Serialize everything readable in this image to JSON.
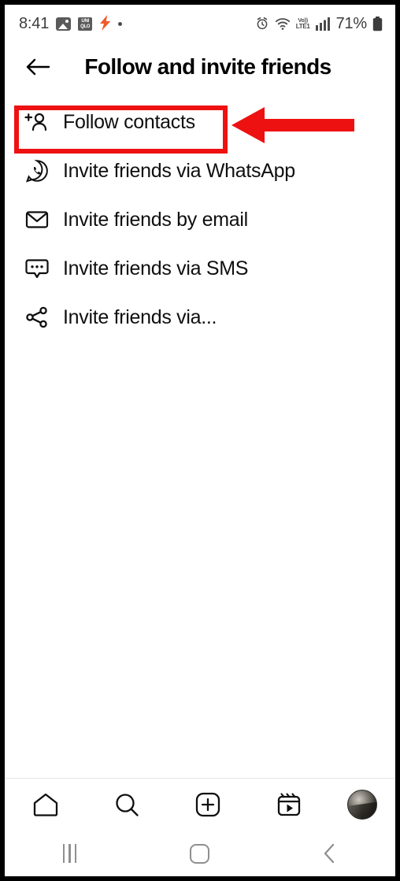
{
  "status_bar": {
    "time": "8:41",
    "left_icons": [
      {
        "name": "gallery-icon",
        "label": "Gallery"
      },
      {
        "name": "uniqlo-app-icon",
        "line1": "UNI",
        "line2": "QLO"
      },
      {
        "name": "charging-bolt-icon",
        "glyph": "⚡"
      },
      {
        "name": "notification-dot-icon",
        "label": "."
      }
    ],
    "right_icons": [
      {
        "name": "alarm-icon"
      },
      {
        "name": "wifi-icon"
      },
      {
        "name": "volte-icon",
        "top": "Vo))",
        "bottom": "LTE1"
      },
      {
        "name": "cellular-signal-icon"
      }
    ],
    "battery_percent": "71%",
    "battery_icon": "battery-icon"
  },
  "header": {
    "back_icon": "back-arrow-icon",
    "title": "Follow and invite friends"
  },
  "options": [
    {
      "id": "follow-contacts",
      "icon": "person-add-icon",
      "label": "Follow contacts",
      "highlighted": true
    },
    {
      "id": "invite-whatsapp",
      "icon": "whatsapp-icon",
      "label": "Invite friends via WhatsApp",
      "highlighted": false
    },
    {
      "id": "invite-email",
      "icon": "envelope-icon",
      "label": "Invite friends by email",
      "highlighted": false
    },
    {
      "id": "invite-sms",
      "icon": "message-bubble-icon",
      "label": "Invite friends via SMS",
      "highlighted": false
    },
    {
      "id": "invite-other",
      "icon": "share-icon",
      "label": "Invite friends via...",
      "highlighted": false
    }
  ],
  "annotation": {
    "color": "#ee1111",
    "box_target": "Follow contacts",
    "arrow_direction": "left"
  },
  "bottom_nav": [
    {
      "id": "home",
      "icon": "home-icon"
    },
    {
      "id": "search",
      "icon": "search-icon"
    },
    {
      "id": "create",
      "icon": "plus-square-icon"
    },
    {
      "id": "reels",
      "icon": "reels-icon"
    },
    {
      "id": "profile",
      "icon": "profile-avatar"
    }
  ],
  "system_nav": [
    {
      "id": "recents",
      "icon": "recents-icon"
    },
    {
      "id": "home",
      "icon": "home-square-icon"
    },
    {
      "id": "back",
      "icon": "back-chevron-icon"
    }
  ]
}
